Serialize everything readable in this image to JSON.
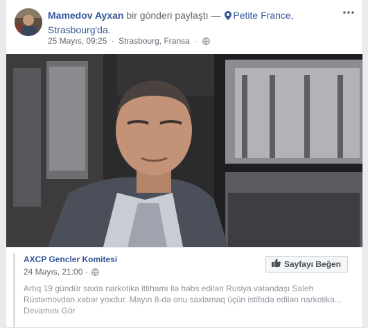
{
  "post": {
    "author": "Mamedov Ayxan",
    "action_text": "bir gönderi paylaştı —",
    "location_line1": "Petite France,",
    "location_line2": "Strasbourg'da.",
    "date": "25 Mayıs, 09:25",
    "separator": "·",
    "place": "Strasbourg, Fransa",
    "separator2": "·",
    "privacy_icon": "globe-icon",
    "more_icon": "more-options-icon"
  },
  "shared": {
    "page_name": "AXCP Gencler Komitesi",
    "date": "24 Mayıs, 21:00",
    "separator": "·",
    "privacy_icon": "globe-icon",
    "like_page_label": "Sayfayı Beğen",
    "body": "Artıq 19 gündür saxta narkotika ittihamı ilə həbs edilən Rusiya vətəndaşı Saleh Rüstəmovdan xəbər yoxdur. Mayın 8-də onu saxlamaq üçün istifadə edilən narkotika...",
    "see_more": "Devamını Gör"
  },
  "colors": {
    "link": "#365899",
    "meta": "#616770",
    "background": "#e9ebee"
  }
}
